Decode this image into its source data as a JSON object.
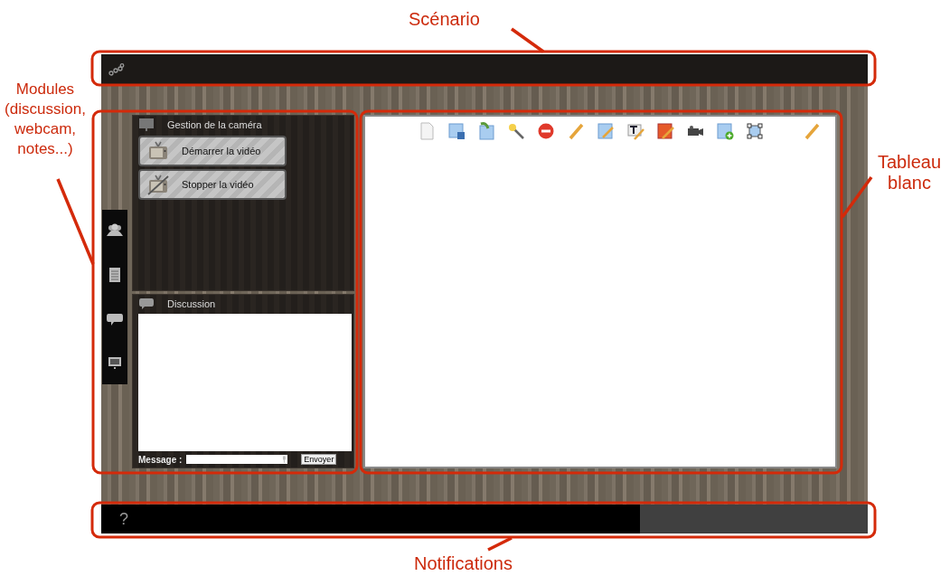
{
  "annotations": [
    {
      "label": "Scénario"
    },
    {
      "label": "Modules (discussion, webcam, notes...)"
    },
    {
      "label": "Tableau blanc"
    },
    {
      "label": "Notifications"
    }
  ],
  "camera_panel": {
    "title": "Gestion de la caméra",
    "buttons": [
      {
        "label": "Démarrer la vidéo",
        "kind": "start"
      },
      {
        "label": "Stopper la vidéo",
        "kind": "stop"
      }
    ]
  },
  "chat_panel": {
    "title": "Discussion",
    "message_label": "Message :",
    "send_button": "Envoyer"
  },
  "notification_bar": {
    "help": "?"
  }
}
